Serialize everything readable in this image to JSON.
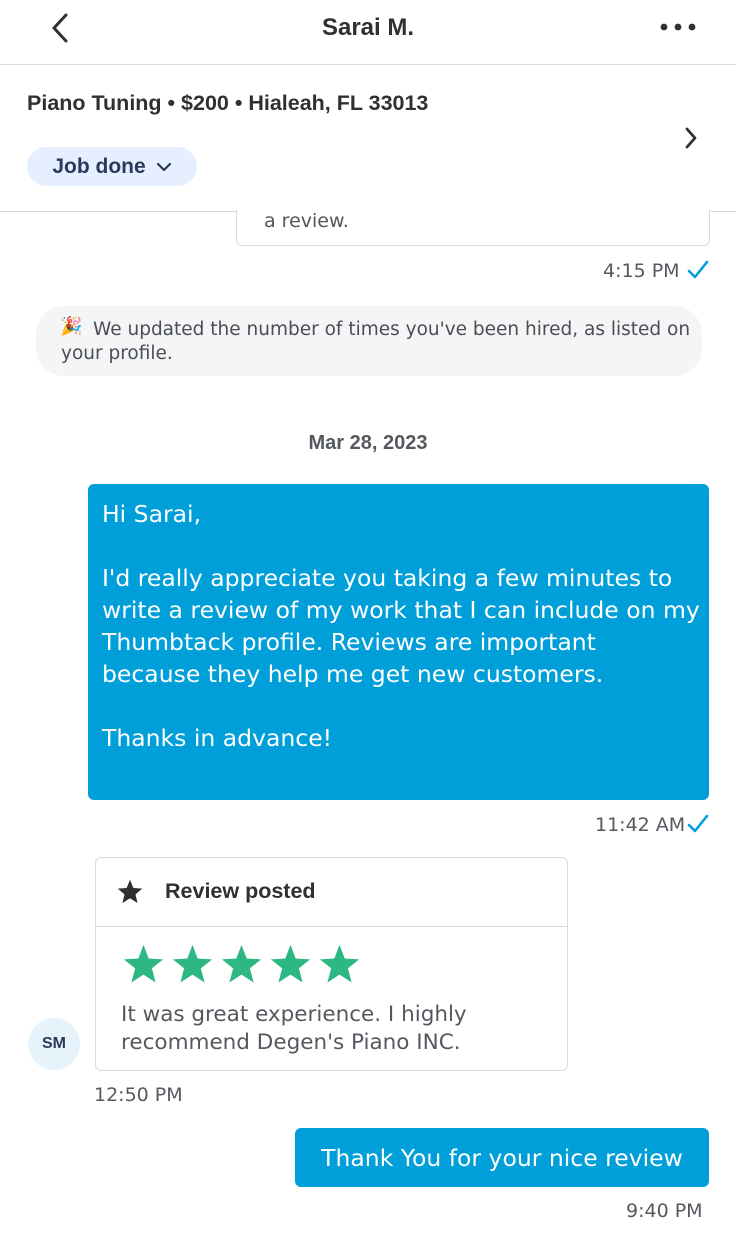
{
  "header": {
    "title": "Sarai M.",
    "back_icon": "chevron-left-icon",
    "more_icon": "ellipsis-icon"
  },
  "job": {
    "summary": "Piano Tuning • $200 • Hialeah, FL 33013",
    "status": "Job done",
    "status_icon": "chevron-down-icon",
    "detail_icon": "chevron-right-icon"
  },
  "conversation": {
    "previous_card_text": "a review.",
    "previous_time": "4:15 PM",
    "notice_icon": "party-popper-icon",
    "notice_text": "We updated the number of times you've been hired, as listed on your profile.",
    "date_separator": "Mar 28, 2023",
    "message_1": {
      "text": "Hi Sarai,\n\nI'd really appreciate you taking a few minutes to write a review of my work that I can include on my Thumbtack profile. Reviews are important because they help me get new customers.\n\nThanks in advance!",
      "time": "11:42 AM"
    },
    "review": {
      "title": "Review posted",
      "rating": 5,
      "rating_max": 5,
      "text": "It was great experience. I highly recommend Degen's Piano INC.",
      "time": "12:50 PM",
      "avatar_initials": "SM"
    },
    "message_2": {
      "text": "Thank You for your nice review",
      "time": "9:40 PM"
    }
  },
  "colors": {
    "accent_blue": "#009fd9",
    "star_green": "#2db783",
    "status_pill_bg": "#e6efff",
    "notice_bg": "#f4f5f6"
  }
}
